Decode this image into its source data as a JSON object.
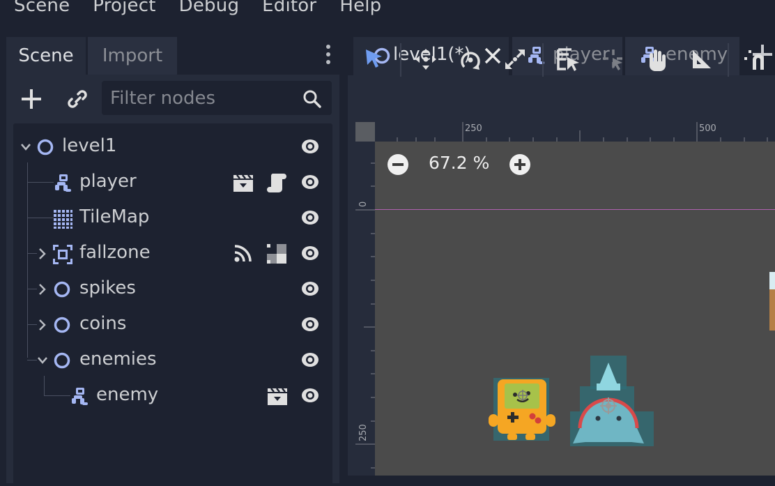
{
  "menu": [
    "Scene",
    "Project",
    "Debug",
    "Editor",
    "Help"
  ],
  "scene_dock": {
    "tabs": [
      "Scene",
      "Import"
    ],
    "filter_placeholder": "Filter nodes",
    "tree": [
      {
        "label": "level1",
        "icon": "node2d-icon"
      },
      {
        "label": "player",
        "icon": "character-icon"
      },
      {
        "label": "TileMap",
        "icon": "tilemap-icon"
      },
      {
        "label": "fallzone",
        "icon": "area2d-icon"
      },
      {
        "label": "spikes",
        "icon": "node2d-icon"
      },
      {
        "label": "coins",
        "icon": "node2d-icon"
      },
      {
        "label": "enemies",
        "icon": "node2d-icon"
      },
      {
        "label": "enemy",
        "icon": "character-icon"
      }
    ]
  },
  "editor_tabs": [
    {
      "label": "level1(*)",
      "active": true
    },
    {
      "label": "player",
      "active": false
    },
    {
      "label": "enemy",
      "active": false
    }
  ],
  "viewport": {
    "zoom": "67.2 %",
    "ruler_top": [
      "250",
      "500"
    ],
    "ruler_left": [
      "0",
      "250"
    ]
  },
  "colors": {
    "accent": "#a5b7f3",
    "background": "#1d2230",
    "panel": "#262c3b",
    "viewport": "#4b4b4b"
  }
}
